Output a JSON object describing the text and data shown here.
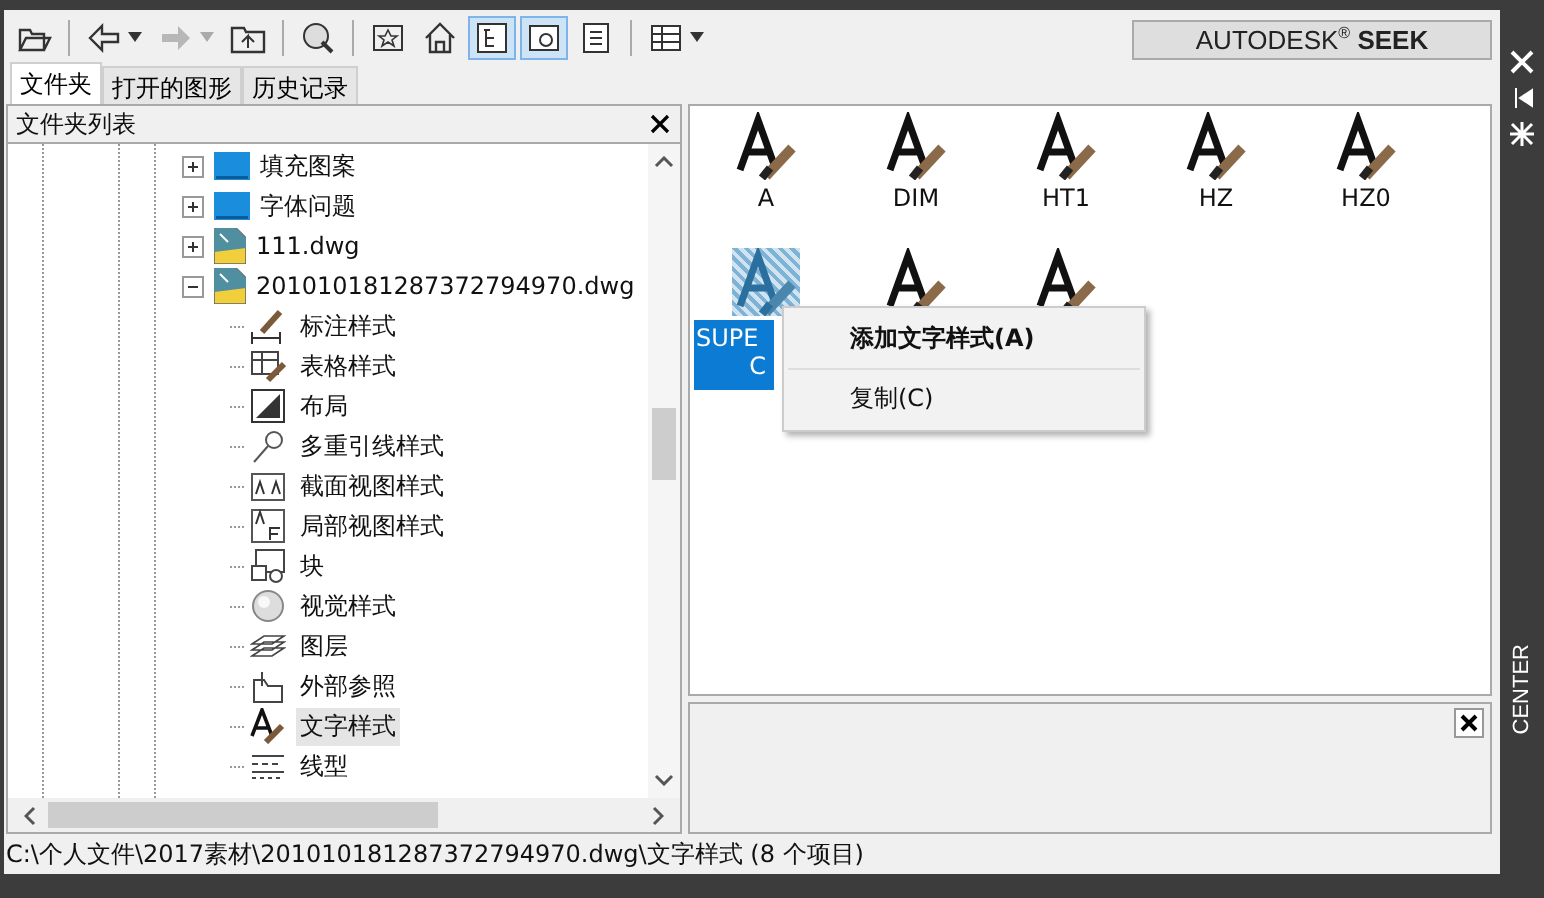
{
  "toolbar": [
    {
      "kind": "open",
      "pressed": false,
      "disabled": false,
      "dropdown": false
    },
    {
      "kind": "back",
      "pressed": false,
      "disabled": false,
      "dropdown": true
    },
    {
      "kind": "forward",
      "pressed": false,
      "disabled": true,
      "dropdown": true
    },
    {
      "kind": "up",
      "pressed": false,
      "disabled": false,
      "dropdown": false
    },
    {
      "kind": "search",
      "pressed": false,
      "disabled": false,
      "dropdown": false
    },
    {
      "kind": "favorites",
      "pressed": false,
      "disabled": false,
      "dropdown": false
    },
    {
      "kind": "home",
      "pressed": false,
      "disabled": false,
      "dropdown": false
    },
    {
      "kind": "tree",
      "pressed": true,
      "disabled": false,
      "dropdown": false
    },
    {
      "kind": "preview",
      "pressed": true,
      "disabled": false,
      "dropdown": false
    },
    {
      "kind": "description",
      "pressed": false,
      "disabled": false,
      "dropdown": false
    },
    {
      "kind": "views",
      "pressed": false,
      "disabled": false,
      "dropdown": true
    }
  ],
  "seek_button": "AUTODESK$^{®}$ **SEEK**",
  "tabs": [
    {
      "label": "文件夹",
      "selected": true
    },
    {
      "label": "打开的图形",
      "selected": false
    },
    {
      "label": "历史记录",
      "selected": false
    }
  ],
  "folder_panel": {
    "title": "文件夹列表",
    "tree": [
      {
        "label": "填充图案",
        "kind": "folder",
        "expanded": false
      },
      {
        "label": "字体问题",
        "kind": "folder",
        "expanded": false
      },
      {
        "label": "111.dwg",
        "kind": "drawing",
        "expanded": false
      },
      {
        "label": "201010181287372794970.dwg",
        "kind": "drawing",
        "expanded": true,
        "children": [
          {
            "label": "标注样式",
            "kind": "dimstyle",
            "selected": false
          },
          {
            "label": "表格样式",
            "kind": "tablestyle",
            "selected": false
          },
          {
            "label": "布局",
            "kind": "layout",
            "selected": false
          },
          {
            "label": "多重引线样式",
            "kind": "mleader",
            "selected": false
          },
          {
            "label": "截面视图样式",
            "kind": "section",
            "selected": false
          },
          {
            "label": "局部视图样式",
            "kind": "detail",
            "selected": false
          },
          {
            "label": "块",
            "kind": "block",
            "selected": false
          },
          {
            "label": "视觉样式",
            "kind": "visual",
            "selected": false
          },
          {
            "label": "图层",
            "kind": "layer",
            "selected": false
          },
          {
            "label": "外部参照",
            "kind": "xref",
            "selected": false
          },
          {
            "label": "文字样式",
            "kind": "textstyle",
            "selected": true
          },
          {
            "label": "线型",
            "kind": "linetype",
            "selected": false
          }
        ]
      }
    ]
  },
  "content": {
    "items": [
      {
        "label_lines": [
          "A"
        ],
        "selected": false
      },
      {
        "label_lines": [
          "DIM"
        ],
        "selected": false
      },
      {
        "label_lines": [
          "HT1"
        ],
        "selected": false
      },
      {
        "label_lines": [
          "HZ"
        ],
        "selected": false
      },
      {
        "label_lines": [
          "HZ0"
        ],
        "selected": false
      },
      {
        "label_lines": [
          "SUPE",
          "C"
        ],
        "selected": true
      },
      {
        "selected": false
      },
      {
        "selected": false
      }
    ]
  },
  "context_menu": {
    "items": [
      {
        "kind": "command",
        "label": "添加文字样式(A)",
        "default": true
      },
      {
        "kind": "separator"
      },
      {
        "kind": "command",
        "label": "复制(C)",
        "default": false
      }
    ]
  },
  "side_panel": {
    "title": "CENTER"
  },
  "status_bar": "C:\\个人文件\\2017素材\\201010181287372794970.dwg\\文字样式 (8 个项目)"
}
